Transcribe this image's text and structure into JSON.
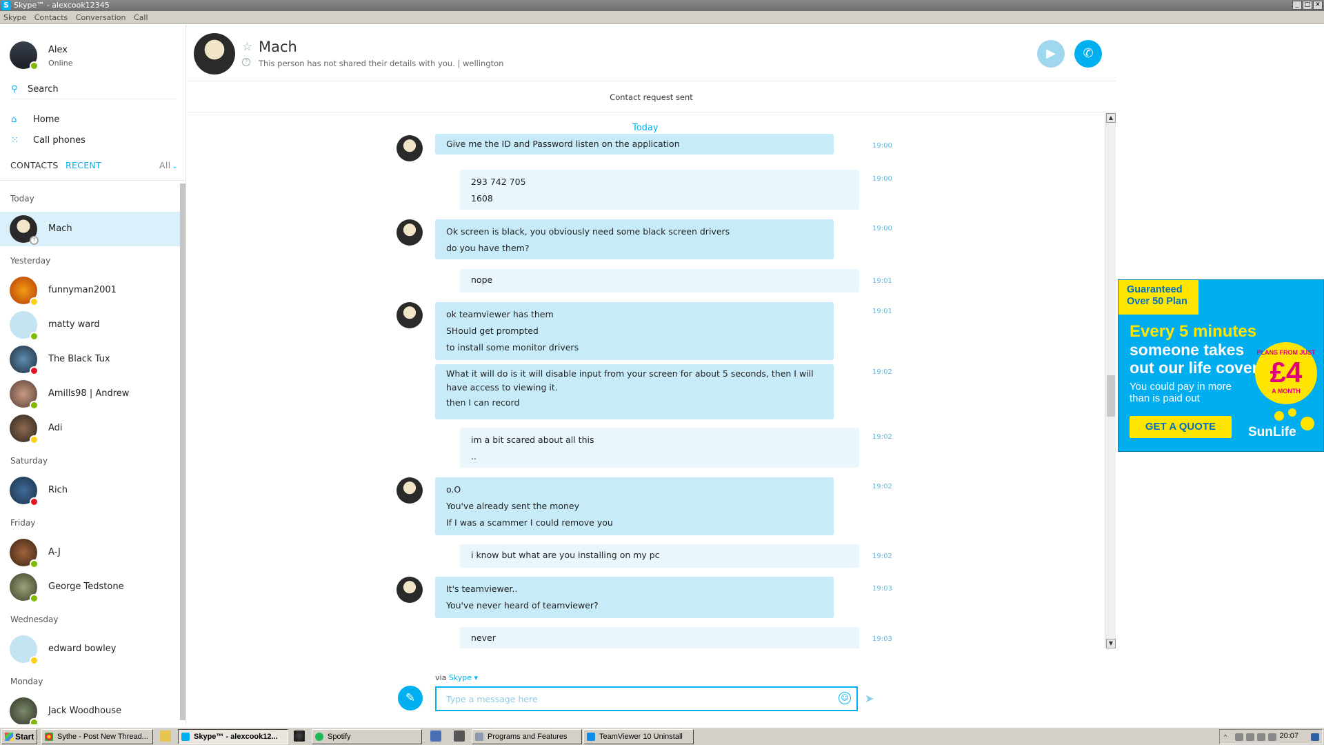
{
  "window": {
    "title": "Skype™ - alexcook12345",
    "app_icon": "S"
  },
  "menu": [
    "Skype",
    "Contacts",
    "Conversation",
    "Call"
  ],
  "profile": {
    "name": "Alex",
    "status": "Online"
  },
  "search": {
    "label": "Search"
  },
  "nav": {
    "home": "Home",
    "call_phones": "Call phones"
  },
  "tabs": {
    "contacts": "CONTACTS",
    "recent": "RECENT",
    "filter": "All"
  },
  "groups": {
    "today": "Today",
    "yesterday": "Yesterday",
    "saturday": "Saturday",
    "friday": "Friday",
    "wednesday": "Wednesday",
    "monday": "Monday"
  },
  "contacts": [
    {
      "name": "Mach",
      "presence": "unknown"
    },
    {
      "name": "funnyman2001",
      "presence": "away"
    },
    {
      "name": "matty ward",
      "presence": "online"
    },
    {
      "name": "The Black Tux",
      "presence": "busy"
    },
    {
      "name": "Amills98 | Andrew",
      "presence": "online"
    },
    {
      "name": "Adi",
      "presence": "away"
    },
    {
      "name": "Rich",
      "presence": "busy"
    },
    {
      "name": "A-J",
      "presence": "online"
    },
    {
      "name": "George Tedstone",
      "presence": "online"
    },
    {
      "name": "edward bowley",
      "presence": "away"
    },
    {
      "name": "Jack Woodhouse",
      "presence": "online"
    }
  ],
  "chat_header": {
    "name": "Mach",
    "subtitle": "This person has not shared their details with you.  |  wellington",
    "request_status": "Contact request sent"
  },
  "conversation": {
    "day_label": "Today",
    "messages": [
      {
        "dir": "in",
        "time": "19:00",
        "lines": [
          "Give me the ID and Password listen on the application"
        ]
      },
      {
        "dir": "out",
        "time": "19:00",
        "lines": [
          "293 742 705",
          "1608"
        ]
      },
      {
        "dir": "in",
        "time": "19:00",
        "lines": [
          "Ok screen is black, you obviously need some black screen drivers",
          "do you have them?"
        ]
      },
      {
        "dir": "out",
        "time": "19:01",
        "lines": [
          "nope"
        ]
      },
      {
        "dir": "in",
        "time": "19:01",
        "lines": [
          "ok teamviewer has them",
          "SHould get prompted",
          "to install some monitor drivers"
        ]
      },
      {
        "dir": "in",
        "time": "19:02",
        "lines": [
          "What it will do is it will disable input from your screen for about 5 seconds, then I will have access to viewing it.",
          "then I can record"
        ]
      },
      {
        "dir": "out",
        "time": "19:02",
        "lines": [
          "im a bit scared about all this",
          ".."
        ]
      },
      {
        "dir": "in",
        "time": "19:02",
        "lines": [
          "o.O",
          "You've already sent the money",
          "If I was a scammer I could remove you"
        ]
      },
      {
        "dir": "out",
        "time": "19:02",
        "lines": [
          "i know but what are you installing on my pc"
        ]
      },
      {
        "dir": "in",
        "time": "19:03",
        "lines": [
          "It's teamviewer..",
          "You've never heard of teamviewer?"
        ]
      },
      {
        "dir": "out",
        "time": "19:03",
        "lines": [
          "never"
        ]
      }
    ]
  },
  "compose": {
    "via_prefix": "via",
    "via_service": "Skype ▾",
    "placeholder": "Type a message here"
  },
  "ad": {
    "badge": "Guaranteed Over 50 Plan",
    "headline_1": "Every 5 minutes",
    "headline_2": "someone takes",
    "headline_3": "out our life cover",
    "body_1": "You could pay in more",
    "body_2": "than is paid out",
    "circle_top": "PLANS FROM JUST",
    "circle_amount": "£4",
    "circle_bottom": "A MONTH",
    "cta": "GET A QUOTE",
    "brand": "SunLife"
  },
  "taskbar": {
    "start": "Start",
    "tasks": [
      "Sythe - Post New Thread...",
      "Skype™ - alexcook12...",
      "Spotify",
      "Programs and Features",
      "TeamViewer 10 Uninstall"
    ],
    "clock": "20:07"
  },
  "colors": {
    "accent": "#00aff0",
    "incoming_bubble": "#c7ebf9",
    "outgoing_bubble": "#e9f6fc",
    "ad_bg": "#00aeef"
  }
}
